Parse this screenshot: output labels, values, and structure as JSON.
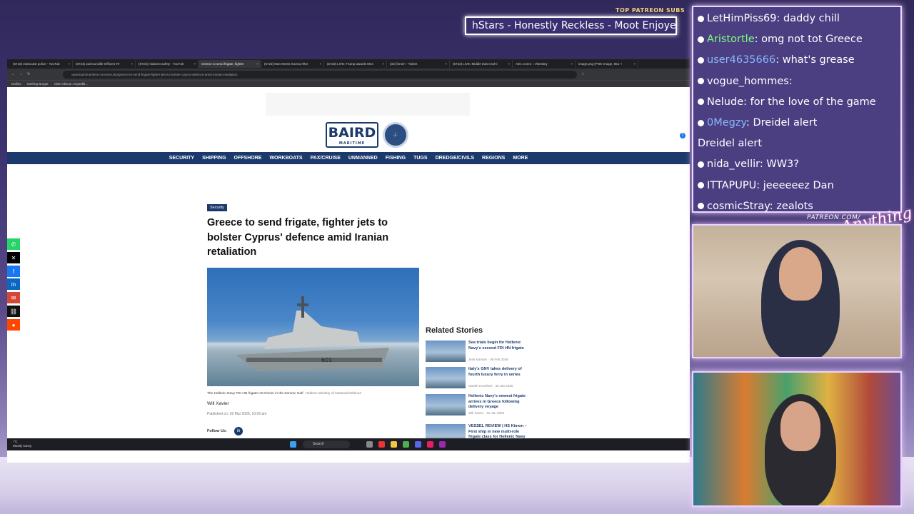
{
  "stream": {
    "patreon_subs_label": "TOP PATREON SUBS",
    "ticker_text": "hStars - Honestly Reckless - Moot Enjoye",
    "patreon_url": "PATREON.COM/",
    "brand_script": "Anything Else"
  },
  "browser": {
    "tabs": [
      {
        "label": "(5723) eastcoast police - YouTub"
      },
      {
        "label": "(5723) Jacksonville Officers Fir"
      },
      {
        "label": "(5723) midwest safety - YouTub"
      },
      {
        "label": "Greece to send frigate, fighter",
        "active": true
      },
      {
        "label": "(5723) Man Meets Karma After"
      },
      {
        "label": "(5723) LIVE: Trump awards Mos"
      },
      {
        "label": "(33) forsen - Twitch"
      },
      {
        "label": "(5723) LIVE: Middle East real-ti"
      },
      {
        "label": "Alex Jones :: r/Destiny"
      },
      {
        "label": "image.png (PNG Image, 851 ×"
      }
    ],
    "address": "www.bairdmaritime.com/security/greece-to-send-frigate-fighter-jets-to-bolster-cyprus-defence-amid-iranian-retaliation",
    "bookmarks": [
      "Dailies",
      "Nothing Burger",
      "Clair Obscur: Expediti..."
    ]
  },
  "site": {
    "logo_text": "BAIRD",
    "logo_sub": "MARITIME",
    "nav": [
      "SECURITY",
      "SHIPPING",
      "OFFSHORE",
      "WORKBOATS",
      "PAX/CRUISE",
      "UNMANNED",
      "FISHING",
      "TUGS",
      "DREDGE/CIVILS",
      "REGIONS",
      "MORE"
    ]
  },
  "article": {
    "category": "Security",
    "title": "Greece to send frigate, fighter jets to bolster Cyprus' defence amid Iranian retaliation",
    "caption": "The Hellenic Navy FDI HN frigate HS Kimon in the Saronic Gulf",
    "caption_credit": "Hellenic Ministry of National Defence",
    "author": "Will Xavier",
    "published": "Published on: 02 Mar 2026, 10:09 am",
    "follow_label": "Follow Us:"
  },
  "related": {
    "heading": "Related Stories",
    "items": [
      {
        "title": "Sea trials begin for Hellenic Navy's second FDI HN frigate",
        "meta": "Jens Karsten · 08 Feb 2026"
      },
      {
        "title": "Italy's GNV takes delivery of fourth luxury ferry in series",
        "meta": "Gareth Hovelock · 30 Jan 2026"
      },
      {
        "title": "Hellenic Navy's newest frigate arrives in Greece following delivery voyage",
        "meta": "Will Xavier · 15 Jan 2026"
      },
      {
        "title": "VESSEL REVIEW | HS Kimon – First ship in new multi-role frigate class for Hellenic Navy",
        "meta": ""
      }
    ]
  },
  "taskbar": {
    "weather_temp": "-°C",
    "weather_desc": "Mostly sunny",
    "search": "Search"
  },
  "chat": [
    {
      "user": "LetHimPiss69",
      "text": ": daddy chill",
      "color": "#ffffff"
    },
    {
      "user": "Aristortle",
      "text": ": omg not tot Greece",
      "color": "#7dff7d"
    },
    {
      "user": "user4635666",
      "text": ": what's grease",
      "color": "#8ab8ff"
    },
    {
      "user": "vogue_hommes",
      "text": ":",
      "color": "#ffffff"
    },
    {
      "user": "Nelude",
      "text": ": for the love of the game",
      "color": "#ffffff"
    },
    {
      "user": "0Megzy",
      "text": ": Dreidel alert",
      "color": "#8ab8ff"
    },
    {
      "user": "",
      "text": "Dreidel alert",
      "color": "#ffffff"
    },
    {
      "user": "nida_vellir",
      "text": ": WW3?",
      "color": "#ffffff"
    },
    {
      "user": "ITTAPUPU",
      "text": ": jeeeeeez Dan",
      "color": "#ffffff"
    },
    {
      "user": "cosmicStray",
      "text": ": zealots",
      "color": "#ffffff"
    }
  ],
  "colors": {
    "navy": "#1b3a6b",
    "accent": "#1877f2"
  }
}
